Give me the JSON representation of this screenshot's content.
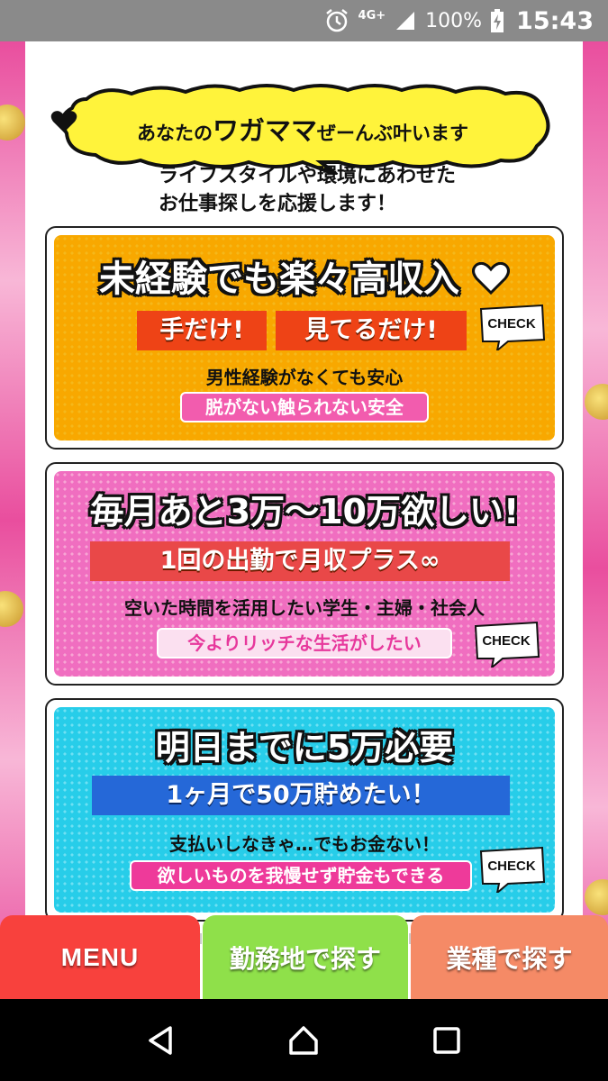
{
  "status_bar": {
    "network": "4G+",
    "battery": "100%",
    "time": "15:43"
  },
  "bubble": {
    "part1": "あなたの",
    "part2": "ワガママ",
    "part3": "ぜーんぶ",
    "part4": "叶います"
  },
  "subtitle": {
    "line1": "ライフスタイルや環境にあわせた",
    "line2": "お仕事探しを応援します！"
  },
  "cards": [
    {
      "headline": "未経験でも楽々高収入",
      "tags": [
        "手だけ!",
        "見てるだけ!"
      ],
      "line": "男性経験がなくても安心",
      "pill": "脱がない触られない安全",
      "check": "CHECK"
    },
    {
      "headline": "毎月あと3万〜10万欲しい!",
      "tags": [
        "1回の出勤で月収プラス∞"
      ],
      "line": "空いた時間を活用したい学生・主婦・社会人",
      "pill": "今よりリッチな生活がしたい",
      "check": "CHECK"
    },
    {
      "headline": "明日までに5万必要",
      "tags": [
        "1ヶ月で50万貯めたい！"
      ],
      "line": "支払いしなきゃ…でもお金ない！",
      "pill": "欲しいものを我慢せず貯金もできる",
      "check": "CHECK"
    }
  ],
  "bottom_nav": {
    "menu": "MENU",
    "area": "勤務地で探す",
    "type": "業種で探す"
  },
  "colors": {
    "card1": "#f8a800",
    "card2": "#f06ec0",
    "card3": "#27cde9",
    "nav_menu": "#f8413d",
    "nav_area": "#8fe04a",
    "nav_type": "#f58a66"
  }
}
